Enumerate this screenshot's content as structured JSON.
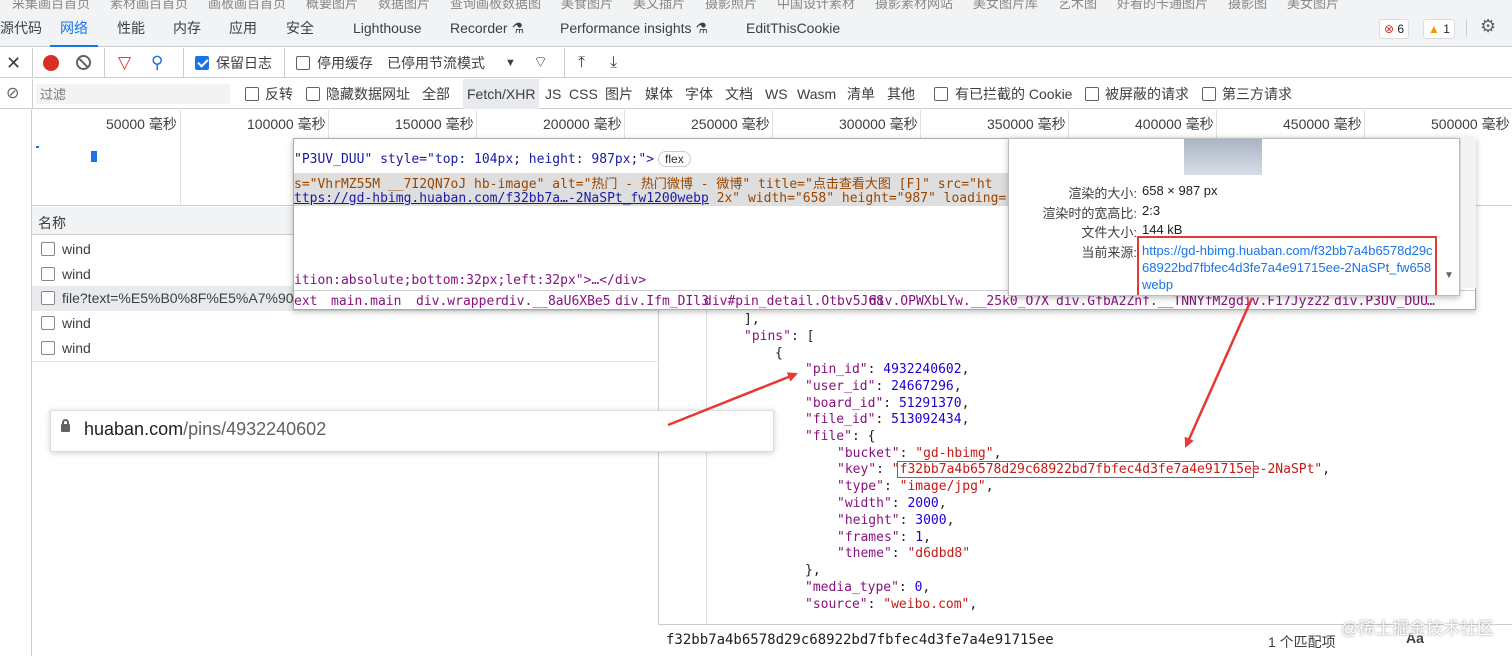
{
  "top_strip": [
    "采集画百首页",
    "素材画百首页",
    "画板画百首页",
    "概要图片",
    "数据图片",
    "查询画板数据图",
    "美食图片",
    "美文插片",
    "摄影照片",
    "中国设计素材",
    "摄影素材网站",
    "美女图片库",
    "艺术图",
    "好看的卡通图片",
    "摄影图",
    "美女图片"
  ],
  "tabs": [
    {
      "label": "源代码",
      "active": false
    },
    {
      "label": "网络",
      "active": true
    },
    {
      "label": "性能",
      "active": false
    },
    {
      "label": "内存",
      "active": false
    },
    {
      "label": "应用",
      "active": false
    },
    {
      "label": "安全",
      "active": false
    },
    {
      "label": "Lighthouse",
      "active": false
    },
    {
      "label": "Recorder ⚗",
      "active": false
    },
    {
      "label": "Performance insights ⚗",
      "active": false
    },
    {
      "label": "EditThisCookie",
      "active": false
    }
  ],
  "badges": {
    "errors": "6",
    "warnings": "1"
  },
  "toolbar": {
    "preserve_log": "保留日志",
    "disable_cache": "停用缓存",
    "throttling": "已停用节流模式"
  },
  "filter": {
    "placeholder": "过滤",
    "invert": "反转",
    "hide_data_urls": "隐藏数据网址",
    "types": [
      "全部",
      "Fetch/XHR",
      "JS",
      "CSS",
      "图片",
      "媒体",
      "字体",
      "文档",
      "WS",
      "Wasm",
      "清单",
      "其他"
    ],
    "selected_type": "Fetch/XHR",
    "blocked_cookies": "有已拦截的 Cookie",
    "blocked_requests": "被屏蔽的请求",
    "third_party": "第三方请求"
  },
  "timeline": {
    "ticks": [
      "50000 毫秒",
      "100000 毫秒",
      "150000 毫秒",
      "200000 毫秒",
      "250000 毫秒",
      "300000 毫秒",
      "350000 毫秒",
      "400000 毫秒",
      "450000 毫秒",
      "500000 毫秒"
    ]
  },
  "requests": {
    "header": "名称",
    "rows": [
      "wind",
      "wind",
      "file?text=%E5%B0%8F%E5%A7%90%",
      "wind",
      "wind"
    ]
  },
  "elements_popup": {
    "line1": "P3UV_DUU\" style=\"top: 104px; height: 987px;\">",
    "line2_prefix": "s=\"VhrMZ55M __7I2QN7oJ hb-image\" alt=\"热门 - 热门微博 - 微博\" title=\"点击查看大图 [F]\" src=\"ht",
    "line3_url": "ttps://gd-hbimg.huaban.com/f32bb7a…-2NaSPt_fw1200webp",
    "line3_rest": " 2x\" width=\"658\" height=\"987\" loading=\"e",
    "line4": "ition:absolute;bottom:32px;left:32px\">…</div>",
    "flex": "flex",
    "crumbs": [
      "ext",
      "main.main",
      "div.wrapper",
      "div.__8aU6XBe5",
      "div.Ifm_DIl3",
      "div#pin_detail.Otbv5J68",
      "div.OPWXbLYw.__25k0_O7X",
      "div.GfbA2Znf.__TNNYfM2g",
      "div.F17Jyz22",
      "div.P3UV_DUU",
      "…"
    ]
  },
  "image_tooltip": {
    "rendered_size_label": "渲染的大小:",
    "rendered_size": "658 × 987 px",
    "aspect_label": "渲染时的宽高比:",
    "aspect": "2:3",
    "filesize_label": "文件大小:",
    "filesize": "144 kB",
    "source_label": "当前来源:",
    "source": "https://gd-hbimg.huaban.com/f32bb7a4b6578d29c68922bd7fbfec4d3fe7a4e91715ee-2NaSPt_fw658webp"
  },
  "url_popup": {
    "domain": "huaban.com",
    "path": "/pins/4932240602"
  },
  "json_view": {
    "l1": "],",
    "l2_key": "\"pins\"",
    "l2_rest": ": [",
    "l3": "{",
    "pin_id_key": "\"pin_id\"",
    "pin_id": "4932240602",
    "user_id_key": "\"user_id\"",
    "user_id": "24667296",
    "board_id_key": "\"board_id\"",
    "board_id": "51291370",
    "file_id_key": "\"file_id\"",
    "file_id": "513092434",
    "file_key": "\"file\"",
    "file_rest": ": {",
    "bucket_key": "\"bucket\"",
    "bucket": "\"gd-hbimg\"",
    "key_key": "\"key\"",
    "key": "\"f32bb7a4b6578d29c68922bd7fbfec4d3fe7a4e91715ee-2NaSPt\"",
    "type_key": "\"type\"",
    "type": "\"image/jpg\"",
    "width_key": "\"width\"",
    "width": "2000",
    "height_key": "\"height\"",
    "height": "3000",
    "frames_key": "\"frames\"",
    "frames": "1",
    "theme_key": "\"theme\"",
    "theme": "\"d6dbd8\"",
    "close": "},",
    "media_type_key": "\"media_type\"",
    "media_type": "0",
    "source_key": "\"source\"",
    "source": "\"weibo.com\""
  },
  "search": {
    "query": "f32bb7a4b6578d29c68922bd7fbfec4d3fe7a4e91715ee",
    "matches": "1 个匹配项",
    "case_button": "Aa"
  },
  "watermark": "@稀土掘金技术社区",
  "colors": {
    "accent": "#1a73e8",
    "annotation_red": "#e53935",
    "record_red": "#d93025"
  }
}
